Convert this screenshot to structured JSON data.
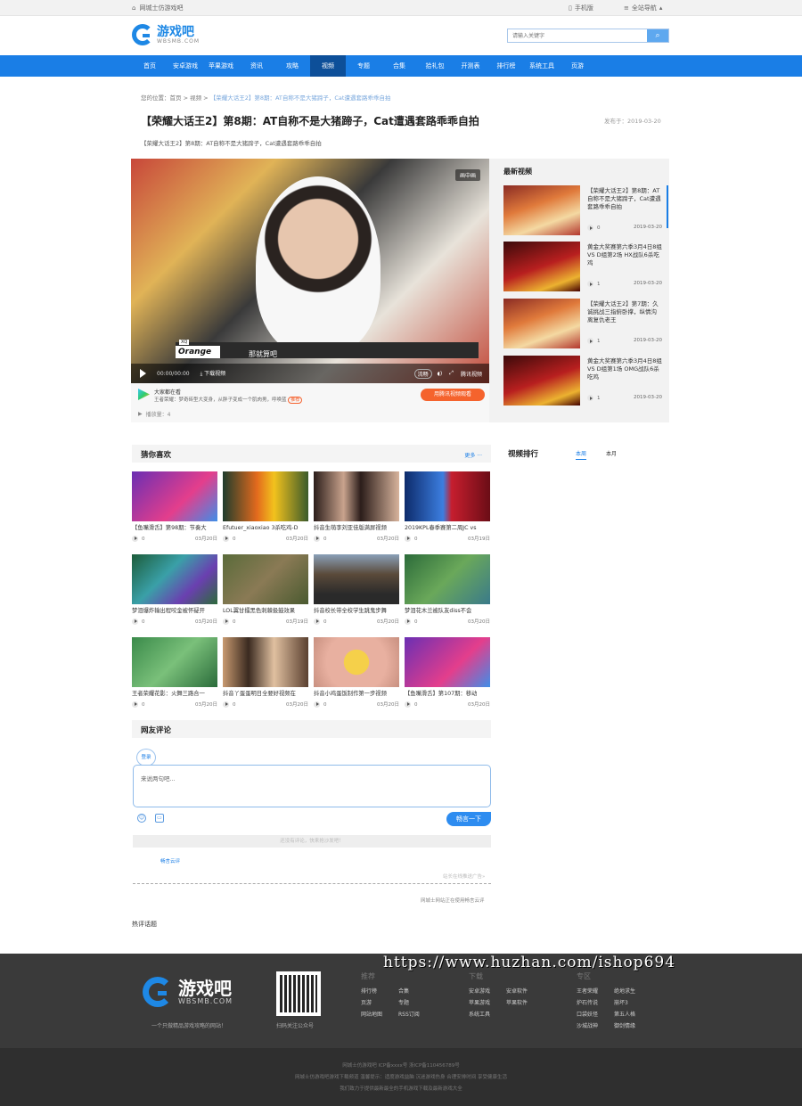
{
  "topbar": {
    "home": "网城士仿游戏吧",
    "mobile": "手机版",
    "sitenav": "全站导航"
  },
  "header": {
    "logo_text": "游戏吧",
    "logo_sub": "WBSMB.COM",
    "search_placeholder": "请输入关键字"
  },
  "nav": [
    "首页",
    "安卓游戏",
    "苹果游戏",
    "资讯",
    "攻略",
    "视频",
    "专题",
    "合集",
    "拾礼包",
    "开测表",
    "排行榜",
    "系统工具",
    "页游"
  ],
  "breadcrumb": {
    "prefix": "您的位置：",
    "home": "首页",
    "sep1": " > ",
    "section": "视频",
    "sep2": " > ",
    "current": "【荣耀大话王2】第8期：AT自称不是大猪蹄子，Cat遭遇套路乖乖自拍"
  },
  "article": {
    "title": "【荣耀大话王2】第8期：AT自称不是大猪蹄子，Cat遭遇套路乖乖自拍",
    "pubdate": "发布于：2019-03-20",
    "subtitle": "【荣耀大话王2】第8期：AT自称不是大猪蹄子，Cat遭遇套路乖乖自拍"
  },
  "player": {
    "badge": "画中画",
    "xq": "XQ",
    "nametag": "Orange",
    "caption": "那就算吧",
    "time": "00:00/00:00",
    "download": "下载视频",
    "quality": "流畅",
    "brand": "腾讯视频"
  },
  "promo": {
    "title": "大家都在看",
    "desc": "王者荣耀：梦奇砖型大变身，从胖子变成一个肌肉男，呼唤蓝",
    "tag": "推荐",
    "button": "用腾讯视频观看",
    "plays": "播放量：4"
  },
  "latest": {
    "heading": "最新视频",
    "items": [
      {
        "title": "【荣耀大话王2】第8期：AT自称不是大猪蹄子，Cat遭遇套路乖乖自拍",
        "count": "0",
        "date": "2019-03-20"
      },
      {
        "title": "黄金大奖赛第六季3月4日8组 VS D组第2场 HX战队6杀吃鸡",
        "count": "1",
        "date": "2019-03-20"
      },
      {
        "title": "【荣耀大话王2】第7期：久诚挑战三指俯卧撑，纵情沟离复仇老王",
        "count": "1",
        "date": "2019-03-20"
      },
      {
        "title": "黄金大奖赛第六季3月4日8组 VS D组第1场 OMG战队6杀吃鸡",
        "count": "1",
        "date": "2019-03-20"
      }
    ]
  },
  "guess": {
    "heading": "猜你喜欢",
    "more": "更多 ···",
    "items": [
      {
        "title": "【鱼嘴滑舌】第98期：节奏大",
        "count": "0",
        "date": "03月20日"
      },
      {
        "title": "Efutuer_xiaoxiao 3杀吃鸡-D",
        "count": "0",
        "date": "03月20日"
      },
      {
        "title": "抖音生萌李刘亚佳版满屏视频",
        "count": "0",
        "date": "03月20日"
      },
      {
        "title": "2019KPL春季赛第二周JC vs",
        "count": "0",
        "date": "03月19日"
      },
      {
        "title": "梦泪爆炸输出程咬金被怀疑开",
        "count": "0",
        "date": "03月20日"
      },
      {
        "title": "LOL翼甘擂黑色刺棘扱鼓效果",
        "count": "0",
        "date": "03月19日"
      },
      {
        "title": "抖音校长带全校学生跳鬼步舞",
        "count": "0",
        "date": "03月20日"
      },
      {
        "title": "梦泪花木兰被队友diss不会",
        "count": "0",
        "date": "03月20日"
      },
      {
        "title": "王者荣耀花影：火舞三路合一",
        "count": "0",
        "date": "03月20日"
      },
      {
        "title": "抖音丫蛋蛋明日全要好视频在",
        "count": "0",
        "date": "03月20日"
      },
      {
        "title": "抖音小鸡蛋饭制作第一步视频",
        "count": "0",
        "date": "03月20日"
      },
      {
        "title": "【鱼嘴滑舌】第107期：移动",
        "count": "0",
        "date": "03月20日"
      }
    ]
  },
  "rank": {
    "heading": "视频排行",
    "tab1": "本周",
    "tab2": "本月"
  },
  "comments": {
    "heading": "网友评论",
    "login": "登录",
    "placeholder": "来说两句吧...",
    "emoji": "☺",
    "image": "▭",
    "post": "畅言一下",
    "empty": "还没有评论，快来抢沙发吧！",
    "changyan": "畅言云评",
    "ad": "站长在线推送广告»",
    "using": "网城士网站正在使用畅言云评",
    "hot": "热评话题"
  },
  "footer": {
    "logo_text": "游戏吧",
    "logo_sub": "WBSMB.COM",
    "slogan": "一个只做精品游戏攻略的网站！",
    "qr_caption": "扫码关注公众号",
    "cols": [
      {
        "heading": "推荐",
        "links": [
          "排行榜",
          "合集",
          "页游",
          "专题",
          "网站地图",
          "RSS订阅"
        ]
      },
      {
        "heading": "下载",
        "links": [
          "安卓游戏",
          "安卓软件",
          "苹果游戏",
          "苹果软件",
          "系统工具"
        ]
      },
      {
        "heading": "专区",
        "links": [
          "王者荣耀",
          "绝地求生",
          "炉石传说",
          "崩坏3",
          "口袋妖怪",
          "第五人格",
          "沙城战神",
          "御剑情缘"
        ]
      }
    ],
    "watermark": "https://www.huzhan.com/ishop694",
    "copyright": [
      "网城士仿游戏吧 ICP备xxxx号 浙ICP备110456789号",
      "网城士仿游戏吧游戏下载频道 温馨提示：适度游戏益脑 沉迷游戏伤身 合理安排时间 享受健康生活",
      "我们致力于提供最新最全的手机游戏下载及最新游戏大全"
    ]
  },
  "colors": {
    "primary": "#1a7ee6",
    "nav_active": "#0d4f99",
    "orange": "#f5632d",
    "footer_bg": "#3a3a3a"
  }
}
